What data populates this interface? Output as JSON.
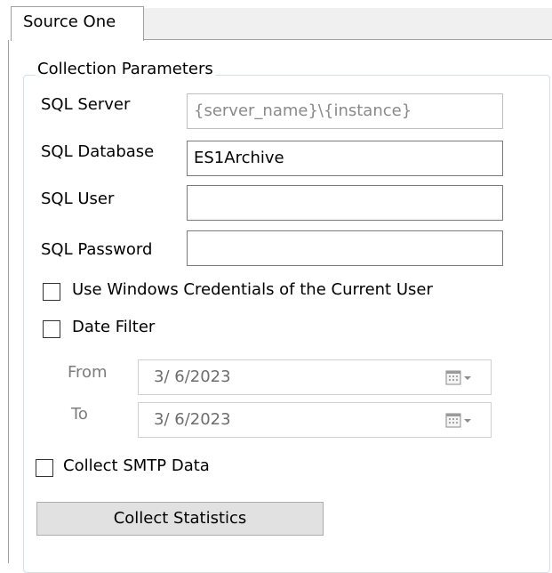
{
  "tabs": {
    "active": "Source One"
  },
  "group": {
    "title": "Collection Parameters",
    "sql_server": {
      "label": "SQL Server",
      "value": "",
      "placeholder": "{server_name}\\{instance}"
    },
    "sql_database": {
      "label": "SQL Database",
      "value": "ES1Archive"
    },
    "sql_user": {
      "label": "SQL User",
      "value": ""
    },
    "sql_password": {
      "label": "SQL Password",
      "value": ""
    },
    "use_windows_credentials": {
      "label": "Use Windows Credentials of the Current User",
      "checked": false
    },
    "date_filter": {
      "label": "Date Filter",
      "checked": false
    },
    "from": {
      "label": "From",
      "value": "3/  6/2023"
    },
    "to": {
      "label": "To",
      "value": "3/  6/2023"
    },
    "collect_smtp": {
      "label": "Collect SMTP Data",
      "checked": false
    },
    "collect_button": "Collect Statistics"
  },
  "icons": {
    "date_picker": "calendar-dropdown-icon"
  },
  "colors": {
    "groupbox_border": "#d5dfe5",
    "button_bg": "#e1e1e1",
    "disabled_text": "#7d7d7d"
  }
}
